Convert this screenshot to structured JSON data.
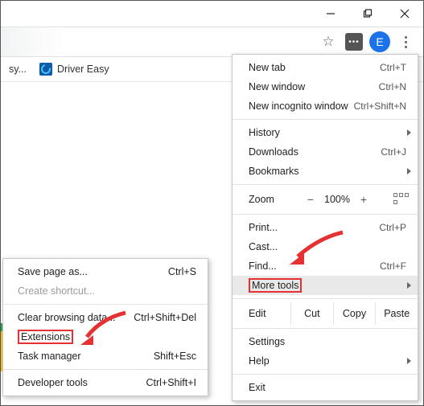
{
  "titlebar": {
    "minimize_label": "Minimize",
    "maximize_label": "Maximize",
    "close_label": "Close"
  },
  "toolbar": {
    "star_tooltip": "Bookmark this page",
    "extension_badge": "•••",
    "avatar_letter": "E",
    "menu_tooltip": "Customize and control Google Chrome"
  },
  "bookmarks": {
    "item0_suffix": "sy...",
    "item1_label": "Driver Easy"
  },
  "menu": {
    "new_tab": "New tab",
    "new_tab_sc": "Ctrl+T",
    "new_window": "New window",
    "new_window_sc": "Ctrl+N",
    "incognito": "New incognito window",
    "incognito_sc": "Ctrl+Shift+N",
    "history": "History",
    "downloads": "Downloads",
    "downloads_sc": "Ctrl+J",
    "bookmarks": "Bookmarks",
    "zoom_label": "Zoom",
    "zoom_minus": "−",
    "zoom_val": "100%",
    "zoom_plus": "+",
    "print": "Print...",
    "print_sc": "Ctrl+P",
    "cast": "Cast...",
    "find": "Find...",
    "find_sc": "Ctrl+F",
    "more_tools": "More tools",
    "edit": "Edit",
    "cut": "Cut",
    "copy": "Copy",
    "paste": "Paste",
    "settings": "Settings",
    "help": "Help",
    "exit": "Exit"
  },
  "submenu": {
    "save_page": "Save page as...",
    "save_page_sc": "Ctrl+S",
    "create_shortcut": "Create shortcut...",
    "clear_data": "Clear browsing data...",
    "clear_data_sc": "Ctrl+Shift+Del",
    "extensions": "Extensions",
    "task_manager": "Task manager",
    "task_manager_sc": "Shift+Esc",
    "dev_tools": "Developer tools",
    "dev_tools_sc": "Ctrl+Shift+I"
  }
}
